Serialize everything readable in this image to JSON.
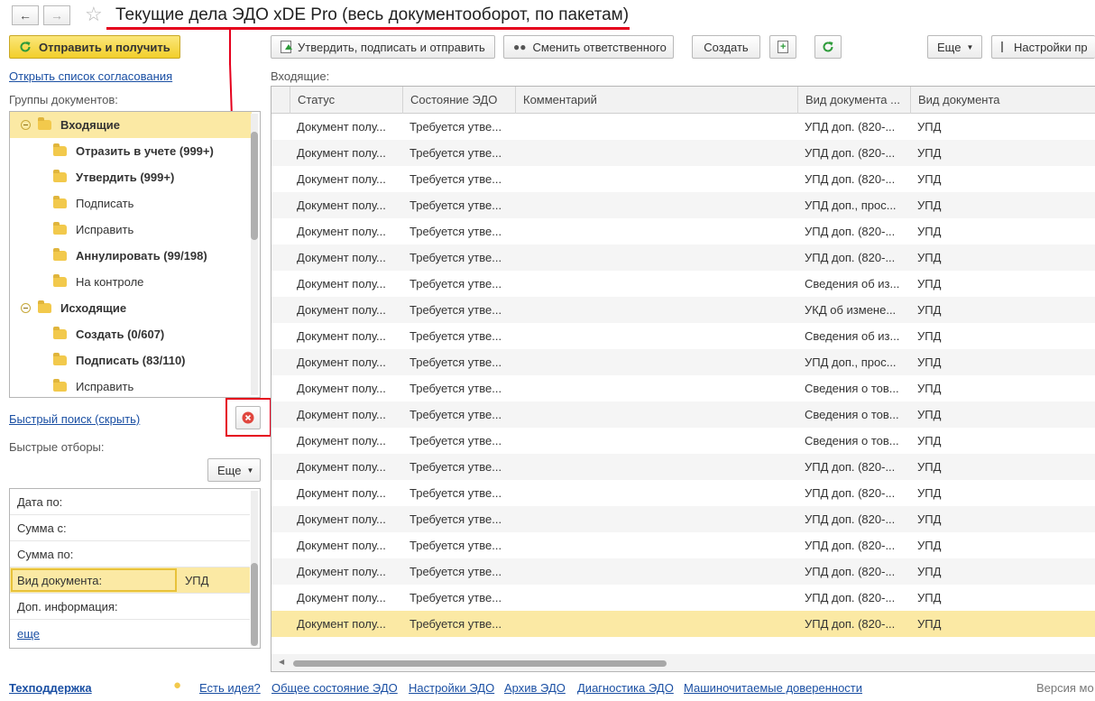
{
  "window": {
    "title": "Текущие дела ЭДО xDE Pro (весь документооборот, по пакетам)"
  },
  "left": {
    "send_receive_label": "Отправить и получить",
    "approval_list_link": "Открыть список согласования",
    "groups_label": "Группы документов:",
    "tree": [
      {
        "label": "Входящие",
        "level": 0,
        "bold": true,
        "selected": true,
        "group": true
      },
      {
        "label": "Отразить в учете (999+)",
        "level": 1,
        "bold": true
      },
      {
        "label": "Утвердить (999+)",
        "level": 1,
        "bold": true
      },
      {
        "label": "Подписать",
        "level": 1,
        "bold": false
      },
      {
        "label": "Исправить",
        "level": 1,
        "bold": false
      },
      {
        "label": "Аннулировать (99/198)",
        "level": 1,
        "bold": true
      },
      {
        "label": "На контроле",
        "level": 1,
        "bold": false
      },
      {
        "label": "Исходящие",
        "level": 0,
        "bold": true,
        "group": true
      },
      {
        "label": "Создать (0/607)",
        "level": 1,
        "bold": true
      },
      {
        "label": "Подписать (83/110)",
        "level": 1,
        "bold": true
      },
      {
        "label": "Исправить",
        "level": 1,
        "bold": false
      }
    ],
    "quick_search_link": "Быстрый поиск (скрыть)",
    "quick_filters_label": "Быстрые отборы:",
    "more_label": "Еще",
    "filters": [
      {
        "label": "Дата по:",
        "value": ""
      },
      {
        "label": "Сумма с:",
        "value": ""
      },
      {
        "label": "Сумма по:",
        "value": ""
      },
      {
        "label": "Вид документа:",
        "value": "УПД",
        "selected": true
      },
      {
        "label": "Доп. информация:",
        "value": ""
      }
    ],
    "more_link": "еще"
  },
  "toolbar": {
    "approve_sign_send": "Утвердить, подписать и отправить",
    "change_responsible": "Сменить ответственного",
    "create": "Создать",
    "more": "Еще",
    "settings": "Настройки пр"
  },
  "table": {
    "section_label": "Входящие:",
    "columns": [
      "Статус",
      "Состояние ЭДО",
      "Комментарий",
      "Вид документа ...",
      "Вид документа"
    ],
    "rows": [
      [
        "Документ полу...",
        "Требуется утве...",
        "",
        "УПД доп. (820-...",
        "УПД"
      ],
      [
        "Документ полу...",
        "Требуется утве...",
        "",
        "УПД доп. (820-...",
        "УПД"
      ],
      [
        "Документ полу...",
        "Требуется утве...",
        "",
        "УПД доп. (820-...",
        "УПД"
      ],
      [
        "Документ полу...",
        "Требуется утве...",
        "",
        "УПД доп., прос...",
        "УПД"
      ],
      [
        "Документ полу...",
        "Требуется утве...",
        "",
        "УПД доп. (820-...",
        "УПД"
      ],
      [
        "Документ полу...",
        "Требуется утве...",
        "",
        "УПД доп. (820-...",
        "УПД"
      ],
      [
        "Документ полу...",
        "Требуется утве...",
        "",
        "Сведения об из...",
        "УПД"
      ],
      [
        "Документ полу...",
        "Требуется утве...",
        "",
        "УКД об измене...",
        "УПД"
      ],
      [
        "Документ полу...",
        "Требуется утве...",
        "",
        "Сведения об из...",
        "УПД"
      ],
      [
        "Документ полу...",
        "Требуется утве...",
        "",
        "УПД доп., прос...",
        "УПД"
      ],
      [
        "Документ полу...",
        "Требуется утве...",
        "",
        "Сведения о тов...",
        "УПД"
      ],
      [
        "Документ полу...",
        "Требуется утве...",
        "",
        "Сведения о тов...",
        "УПД"
      ],
      [
        "Документ полу...",
        "Требуется утве...",
        "",
        "Сведения о тов...",
        "УПД"
      ],
      [
        "Документ полу...",
        "Требуется утве...",
        "",
        "УПД доп. (820-...",
        "УПД"
      ],
      [
        "Документ полу...",
        "Требуется утве...",
        "",
        "УПД доп. (820-...",
        "УПД"
      ],
      [
        "Документ полу...",
        "Требуется утве...",
        "",
        "УПД доп. (820-...",
        "УПД"
      ],
      [
        "Документ полу...",
        "Требуется утве...",
        "",
        "УПД доп. (820-...",
        "УПД"
      ],
      [
        "Документ полу...",
        "Требуется утве...",
        "",
        "УПД доп. (820-...",
        "УПД"
      ],
      [
        "Документ полу...",
        "Требуется утве...",
        "",
        "УПД доп. (820-...",
        "УПД"
      ],
      [
        "Документ полу...",
        "Требуется утве...",
        "",
        "УПД доп. (820-...",
        "УПД"
      ]
    ],
    "selected_row": 19
  },
  "footer": {
    "support": "Техподдержка",
    "idea": "Есть идея?",
    "general_state": "Общее состояние ЭДО",
    "settings": "Настройки ЭДО",
    "archive": "Архив ЭДО",
    "diagnostics": "Диагностика ЭДО",
    "machine_poa": "Машиночитаемые доверенности",
    "version": "Версия мо"
  },
  "colors": {
    "accent_yellow": "#f7de4a",
    "selection": "#fbe9a4",
    "link": "#1a4fa3",
    "annotation_red": "#e5001c",
    "refresh_green": "#2e9b3a"
  }
}
